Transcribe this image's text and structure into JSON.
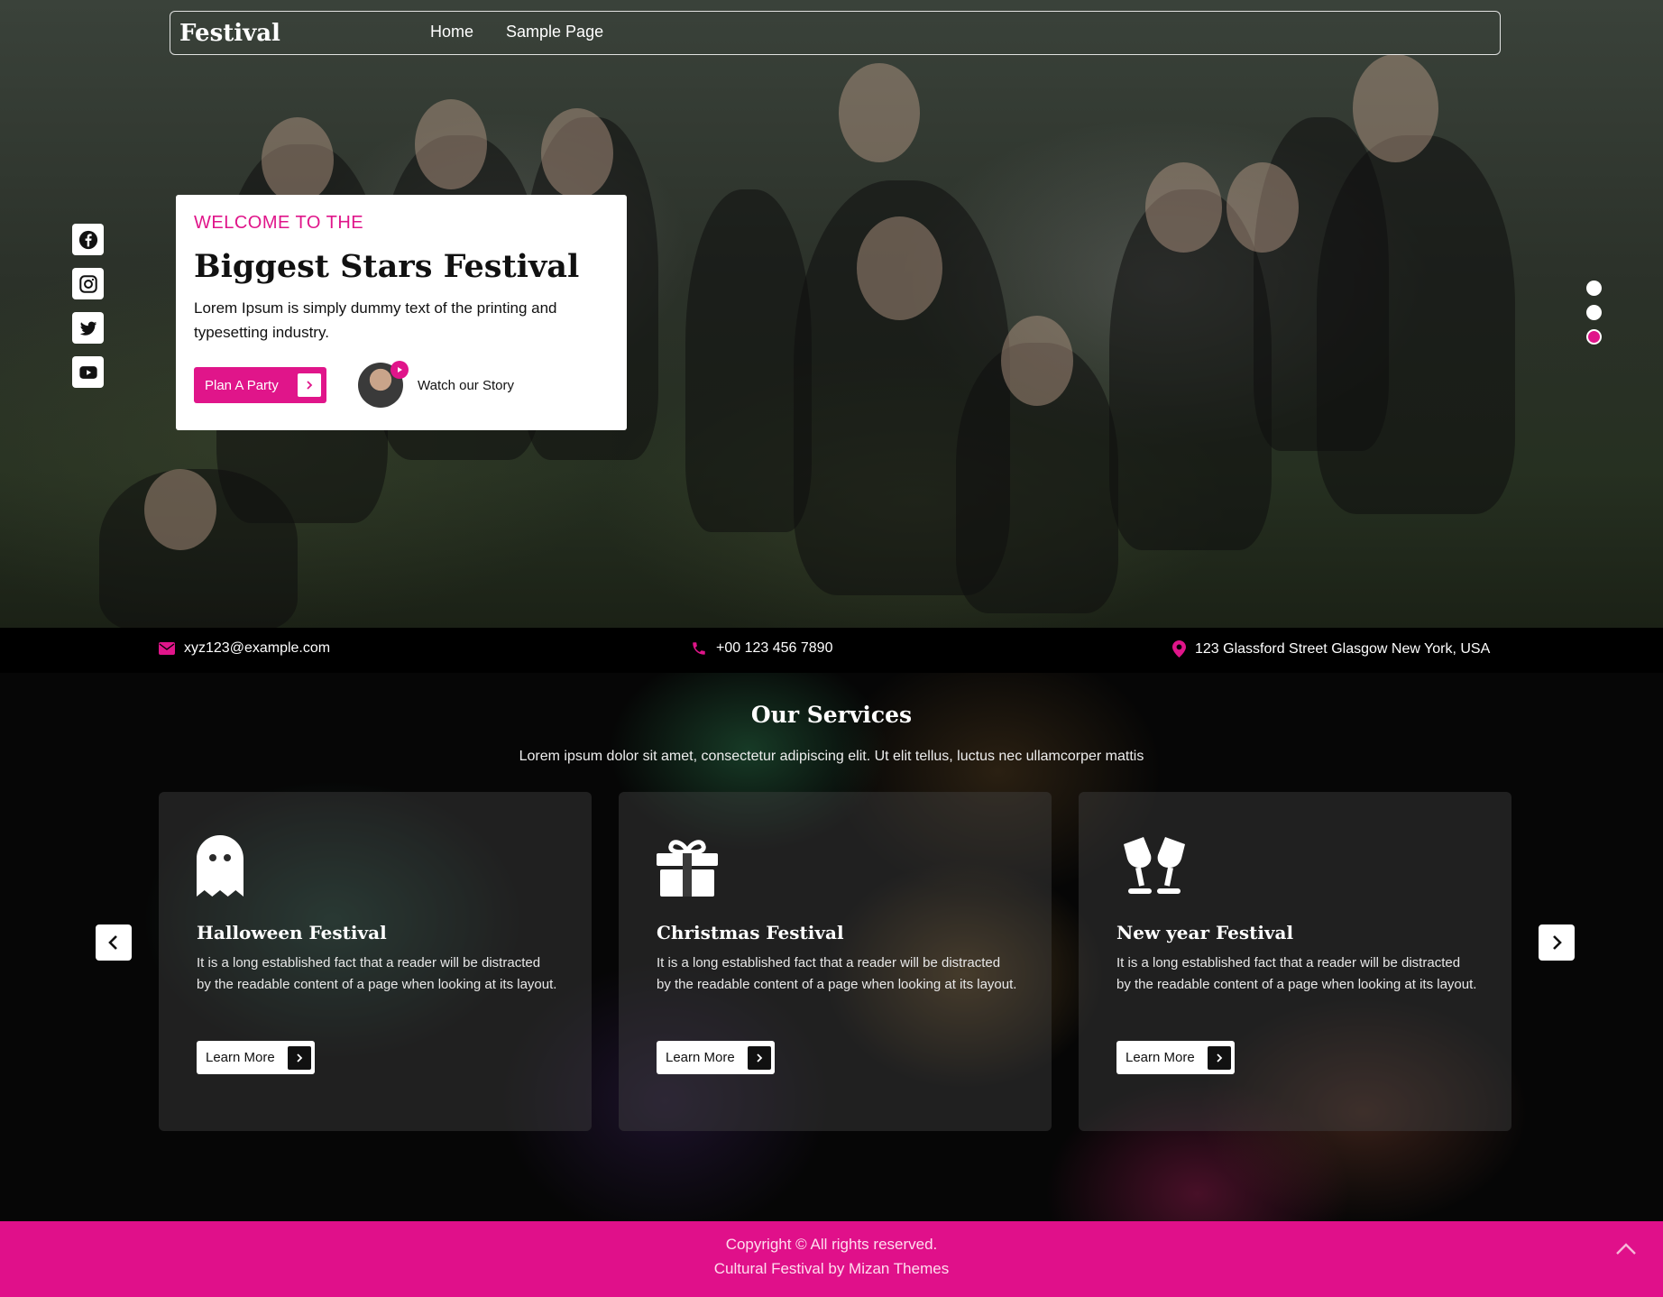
{
  "brand": "Festival",
  "nav": [
    "Home",
    "Sample Page"
  ],
  "social": [
    "facebook-icon",
    "instagram-icon",
    "twitter-icon",
    "youtube-icon"
  ],
  "slider": {
    "dots": 3,
    "active_index": 2
  },
  "hero": {
    "welcome": "WELCOME TO THE",
    "title": "Biggest Stars Festival",
    "text": "Lorem Ipsum is simply dummy text of the printing and typesetting industry.",
    "cta": "Plan A Party",
    "watch": "Watch our Story"
  },
  "contact": {
    "email": "xyz123@example.com",
    "phone": "+00 123 456 7890",
    "address": "123 Glassford Street Glasgow New York, USA"
  },
  "services": {
    "title": "Our Services",
    "subtitle": "Lorem ipsum dolor sit amet, consectetur adipiscing elit. Ut elit tellus, luctus nec ullamcorper mattis",
    "cards": [
      {
        "icon": "ghost-icon",
        "title": "Halloween Festival",
        "text": "It is a long established fact that a reader will be distracted by the readable content of a page when looking at its layout.",
        "button": "Learn More"
      },
      {
        "icon": "gift-icon",
        "title": "Christmas Festival",
        "text": "It is a long established fact that a reader will be distracted by the readable content of a page when looking at its layout.",
        "button": "Learn More"
      },
      {
        "icon": "glasses-cheers-icon",
        "title": "New year Festival",
        "text": "It is a long established fact that a reader will be distracted by the readable content of a page when looking at its layout.",
        "button": "Learn More"
      }
    ]
  },
  "footer": {
    "copyright": "Copyright © All rights reserved.",
    "credit": "Cultural Festival by Mizan Themes"
  },
  "colors": {
    "accent": "#e0158a",
    "footer": "#e0108a",
    "dark": "#050505"
  }
}
